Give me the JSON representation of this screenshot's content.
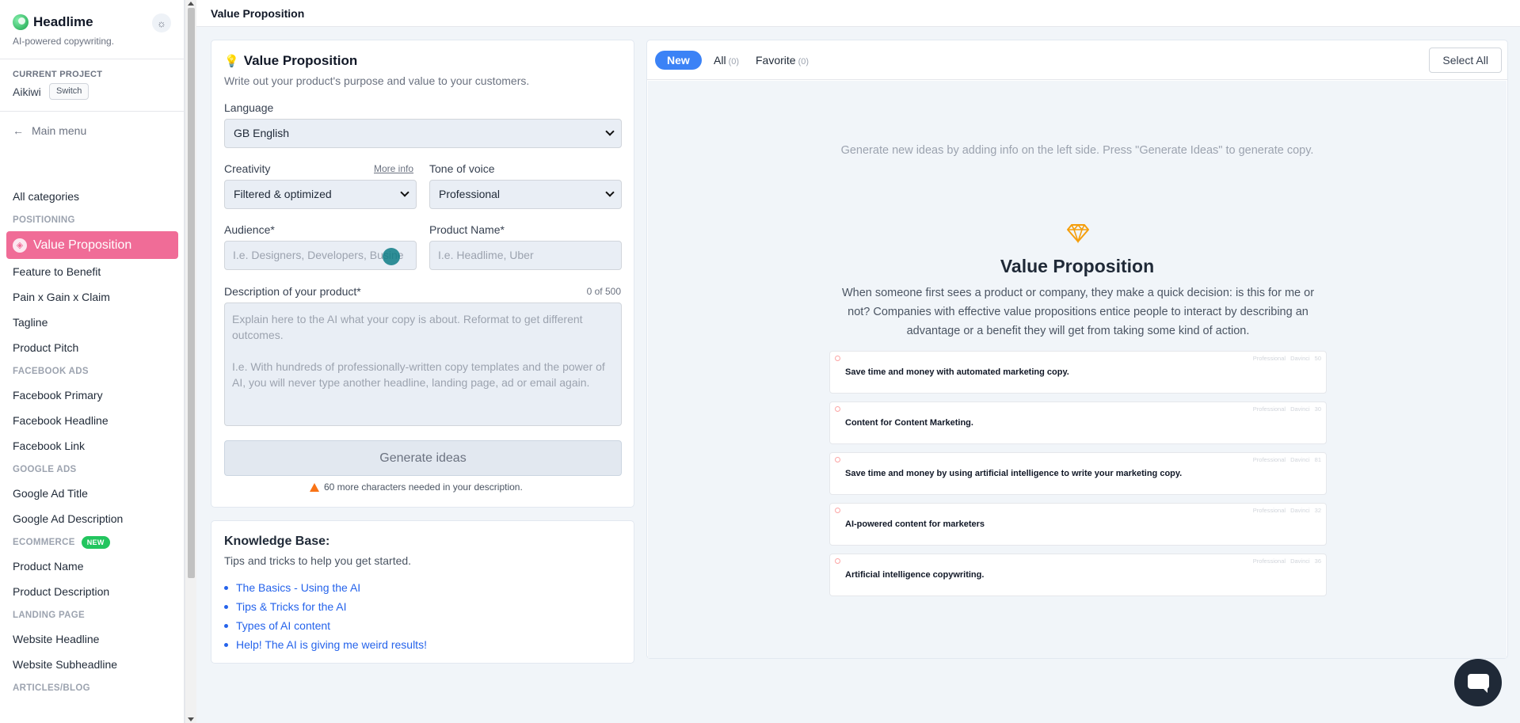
{
  "brand": {
    "name": "Headlime",
    "tagline": "AI-powered copywriting."
  },
  "project": {
    "label": "CURRENT PROJECT",
    "name": "Aikiwi",
    "switch_label": "Switch"
  },
  "main_menu": "Main menu",
  "sidebar": {
    "all_categories": "All categories",
    "sections": [
      {
        "heading": "POSITIONING",
        "items": [
          "Value Proposition",
          "Feature to Benefit",
          "Pain x Gain x Claim",
          "Tagline",
          "Product Pitch"
        ]
      },
      {
        "heading": "FACEBOOK ADS",
        "items": [
          "Facebook Primary",
          "Facebook Headline",
          "Facebook Link"
        ]
      },
      {
        "heading": "GOOGLE ADS",
        "items": [
          "Google Ad Title",
          "Google Ad Description"
        ]
      },
      {
        "heading": "ECOMMERCE",
        "badge": "NEW",
        "items": [
          "Product Name",
          "Product Description"
        ]
      },
      {
        "heading": "LANDING PAGE",
        "items": [
          "Website Headline",
          "Website Subheadline"
        ]
      },
      {
        "heading": "ARTICLES/BLOG",
        "items": []
      }
    ]
  },
  "topbar": {
    "title": "Value Proposition"
  },
  "form": {
    "title": "Value Proposition",
    "subtitle": "Write out your product's purpose and value to your customers.",
    "language_label": "Language",
    "language_value": "GB English",
    "creativity_label": "Creativity",
    "more_info": "More info",
    "creativity_value": "Filtered & optimized",
    "tone_label": "Tone of voice",
    "tone_value": "Professional",
    "audience_label": "Audience*",
    "audience_placeholder": "I.e. Designers, Developers, Busine",
    "product_label": "Product Name*",
    "product_placeholder": "I.e. Headlime, Uber",
    "description_label": "Description of your product*",
    "char_count": "0 of 500",
    "description_placeholder": "Explain here to the AI what your copy is about. Reformat to get different outcomes.\n\nI.e. With hundreds of professionally-written copy templates and the power of AI, you will never type another headline, landing page, ad or email again.",
    "generate_label": "Generate ideas",
    "warning": "60 more characters needed in your description."
  },
  "knowledge_base": {
    "title": "Knowledge Base:",
    "subtitle": "Tips and tricks to help you get started.",
    "links": [
      "The Basics - Using the AI",
      "Tips & Tricks for the AI",
      "Types of AI content",
      "Help! The AI is giving me weird results!"
    ]
  },
  "results": {
    "tabs": {
      "new": "New",
      "all": "All",
      "all_count": "(0)",
      "favorite": "Favorite",
      "favorite_count": "(0)"
    },
    "select_all": "Select All",
    "hint": "Generate new ideas by adding info on the left side. Press \"Generate Ideas\" to generate copy.",
    "title": "Value Proposition",
    "description": "When someone first sees a product or company, they make a quick decision: is this for me or not? Companies with effective value propositions entice people to interact by describing an advantage or a benefit they will get from taking some kind of action.",
    "examples": [
      {
        "text": "Save time and money with automated marketing copy.",
        "tone": "Professional",
        "engine": "Davinci",
        "count": "50"
      },
      {
        "text": "Content for Content Marketing.",
        "tone": "Professional",
        "engine": "Davinci",
        "count": "30"
      },
      {
        "text": "Save time and money by using artificial intelligence to write your marketing copy.",
        "tone": "Professional",
        "engine": "Davinci",
        "count": "81"
      },
      {
        "text": "AI-powered content for marketers",
        "tone": "Professional",
        "engine": "Davinci",
        "count": "32"
      },
      {
        "text": "Artificial intelligence copywriting.",
        "tone": "Professional",
        "engine": "Davinci",
        "count": "36"
      }
    ]
  },
  "colors": {
    "accent": "#f06c97",
    "primary": "#3b82f6",
    "success": "#22c55e",
    "warning": "#f97316"
  }
}
